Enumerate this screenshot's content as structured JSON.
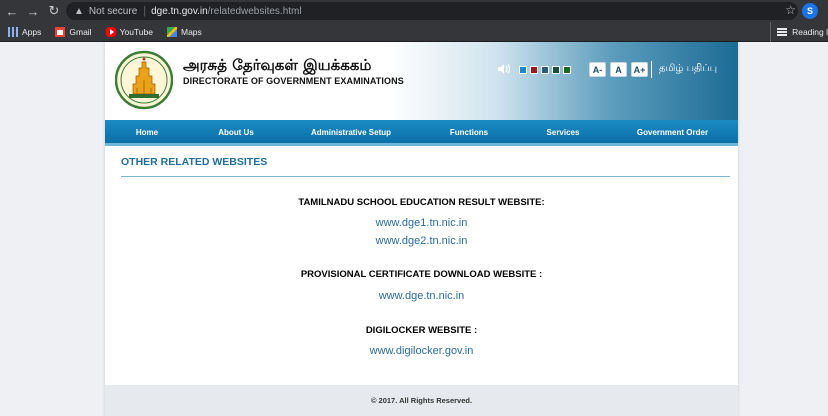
{
  "browser": {
    "security_label": "Not secure",
    "url_domain": "dge.tn.gov.in",
    "url_path": "/relatedwebsites.html",
    "profile_initial": "S",
    "bookmarks": [
      "Apps",
      "Gmail",
      "YouTube",
      "Maps"
    ],
    "reading_list": "Reading l"
  },
  "header": {
    "title_tamil": "அரசுத் தேர்வுகள் இயக்ககம்",
    "title_english": "DIRECTORATE OF GOVERNMENT EXAMINATIONS",
    "theme_colors": [
      "#1e88c8",
      "#a01818",
      "#2e5d7a",
      "#1d4d3a",
      "#1a6a1a"
    ],
    "font_buttons": [
      "A-",
      "A",
      "A+"
    ],
    "language_link": "தமிழ் பதிப்பு"
  },
  "nav": {
    "items": [
      "Home",
      "About Us",
      "Administrative Setup",
      "Functions",
      "Services",
      "Government Order"
    ]
  },
  "content": {
    "section_title": "OTHER RELATED WEBSITES",
    "groups": [
      {
        "heading": "TAMILNADU SCHOOL EDUCATION RESULT WEBSITE:",
        "links": [
          "www.dge1.tn.nic.in",
          "www.dge2.tn.nic.in"
        ]
      },
      {
        "heading": "PROVISIONAL CERTIFICATE DOWNLOAD WEBSITE :",
        "links": [
          "www.dge.tn.nic.in"
        ]
      },
      {
        "heading": "DIGILOCKER WEBSITE :",
        "links": [
          "www.digilocker.gov.in"
        ]
      }
    ]
  },
  "footer": {
    "copyright": "© 2017. All Rights Reserved."
  }
}
